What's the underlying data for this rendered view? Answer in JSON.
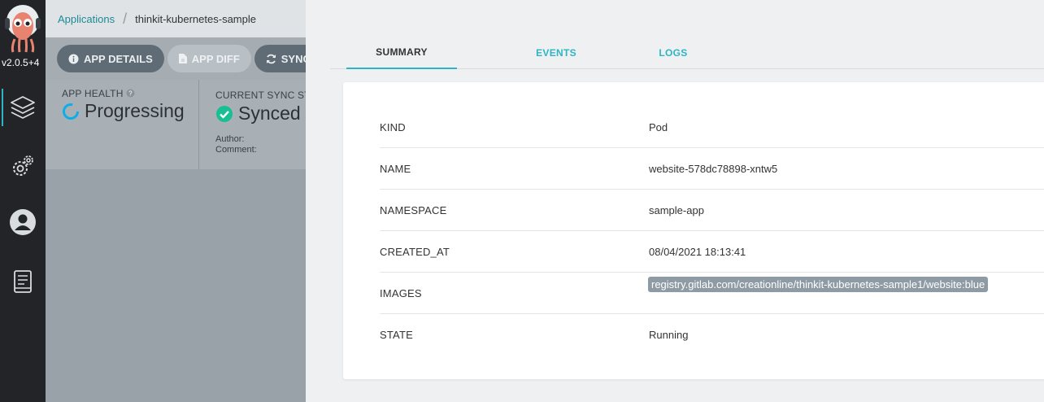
{
  "nav": {
    "version": "v2.0.5+4",
    "items": [
      {
        "icon": "layers-icon",
        "active": true
      },
      {
        "icon": "gears-icon",
        "active": false
      },
      {
        "icon": "user-icon",
        "active": false
      },
      {
        "icon": "docs-icon",
        "active": false
      }
    ]
  },
  "breadcrumb": {
    "root": "Applications",
    "current": "thinkit-kubernetes-sample"
  },
  "toolbar": {
    "app_details": "APP DETAILS",
    "app_diff": "APP DIFF",
    "sync": "SYNC"
  },
  "status": {
    "health_label": "APP HEALTH",
    "health_value": "Progressing",
    "sync_label": "CURRENT SYNC ST",
    "sync_value": "Synced",
    "author_label": "Author:",
    "comment_label": "Comment:"
  },
  "tabs": [
    "SUMMARY",
    "EVENTS",
    "LOGS"
  ],
  "summary": {
    "kind_label": "KIND",
    "kind_value": "Pod",
    "name_label": "NAME",
    "name_value": "website-578dc78898-xntw5",
    "namespace_label": "NAMESPACE",
    "namespace_value": "sample-app",
    "created_label": "CREATED_AT",
    "created_value": "08/04/2021 18:13:41",
    "images_label": "IMAGES",
    "images_value": "registry.gitlab.com/creationline/thinkit-kubernetes-sample1/website:blue",
    "state_label": "STATE",
    "state_value": "Running"
  },
  "colors": {
    "accent": "#2eb4c4",
    "nav_bg": "#222428",
    "synced_green": "#18be94"
  }
}
